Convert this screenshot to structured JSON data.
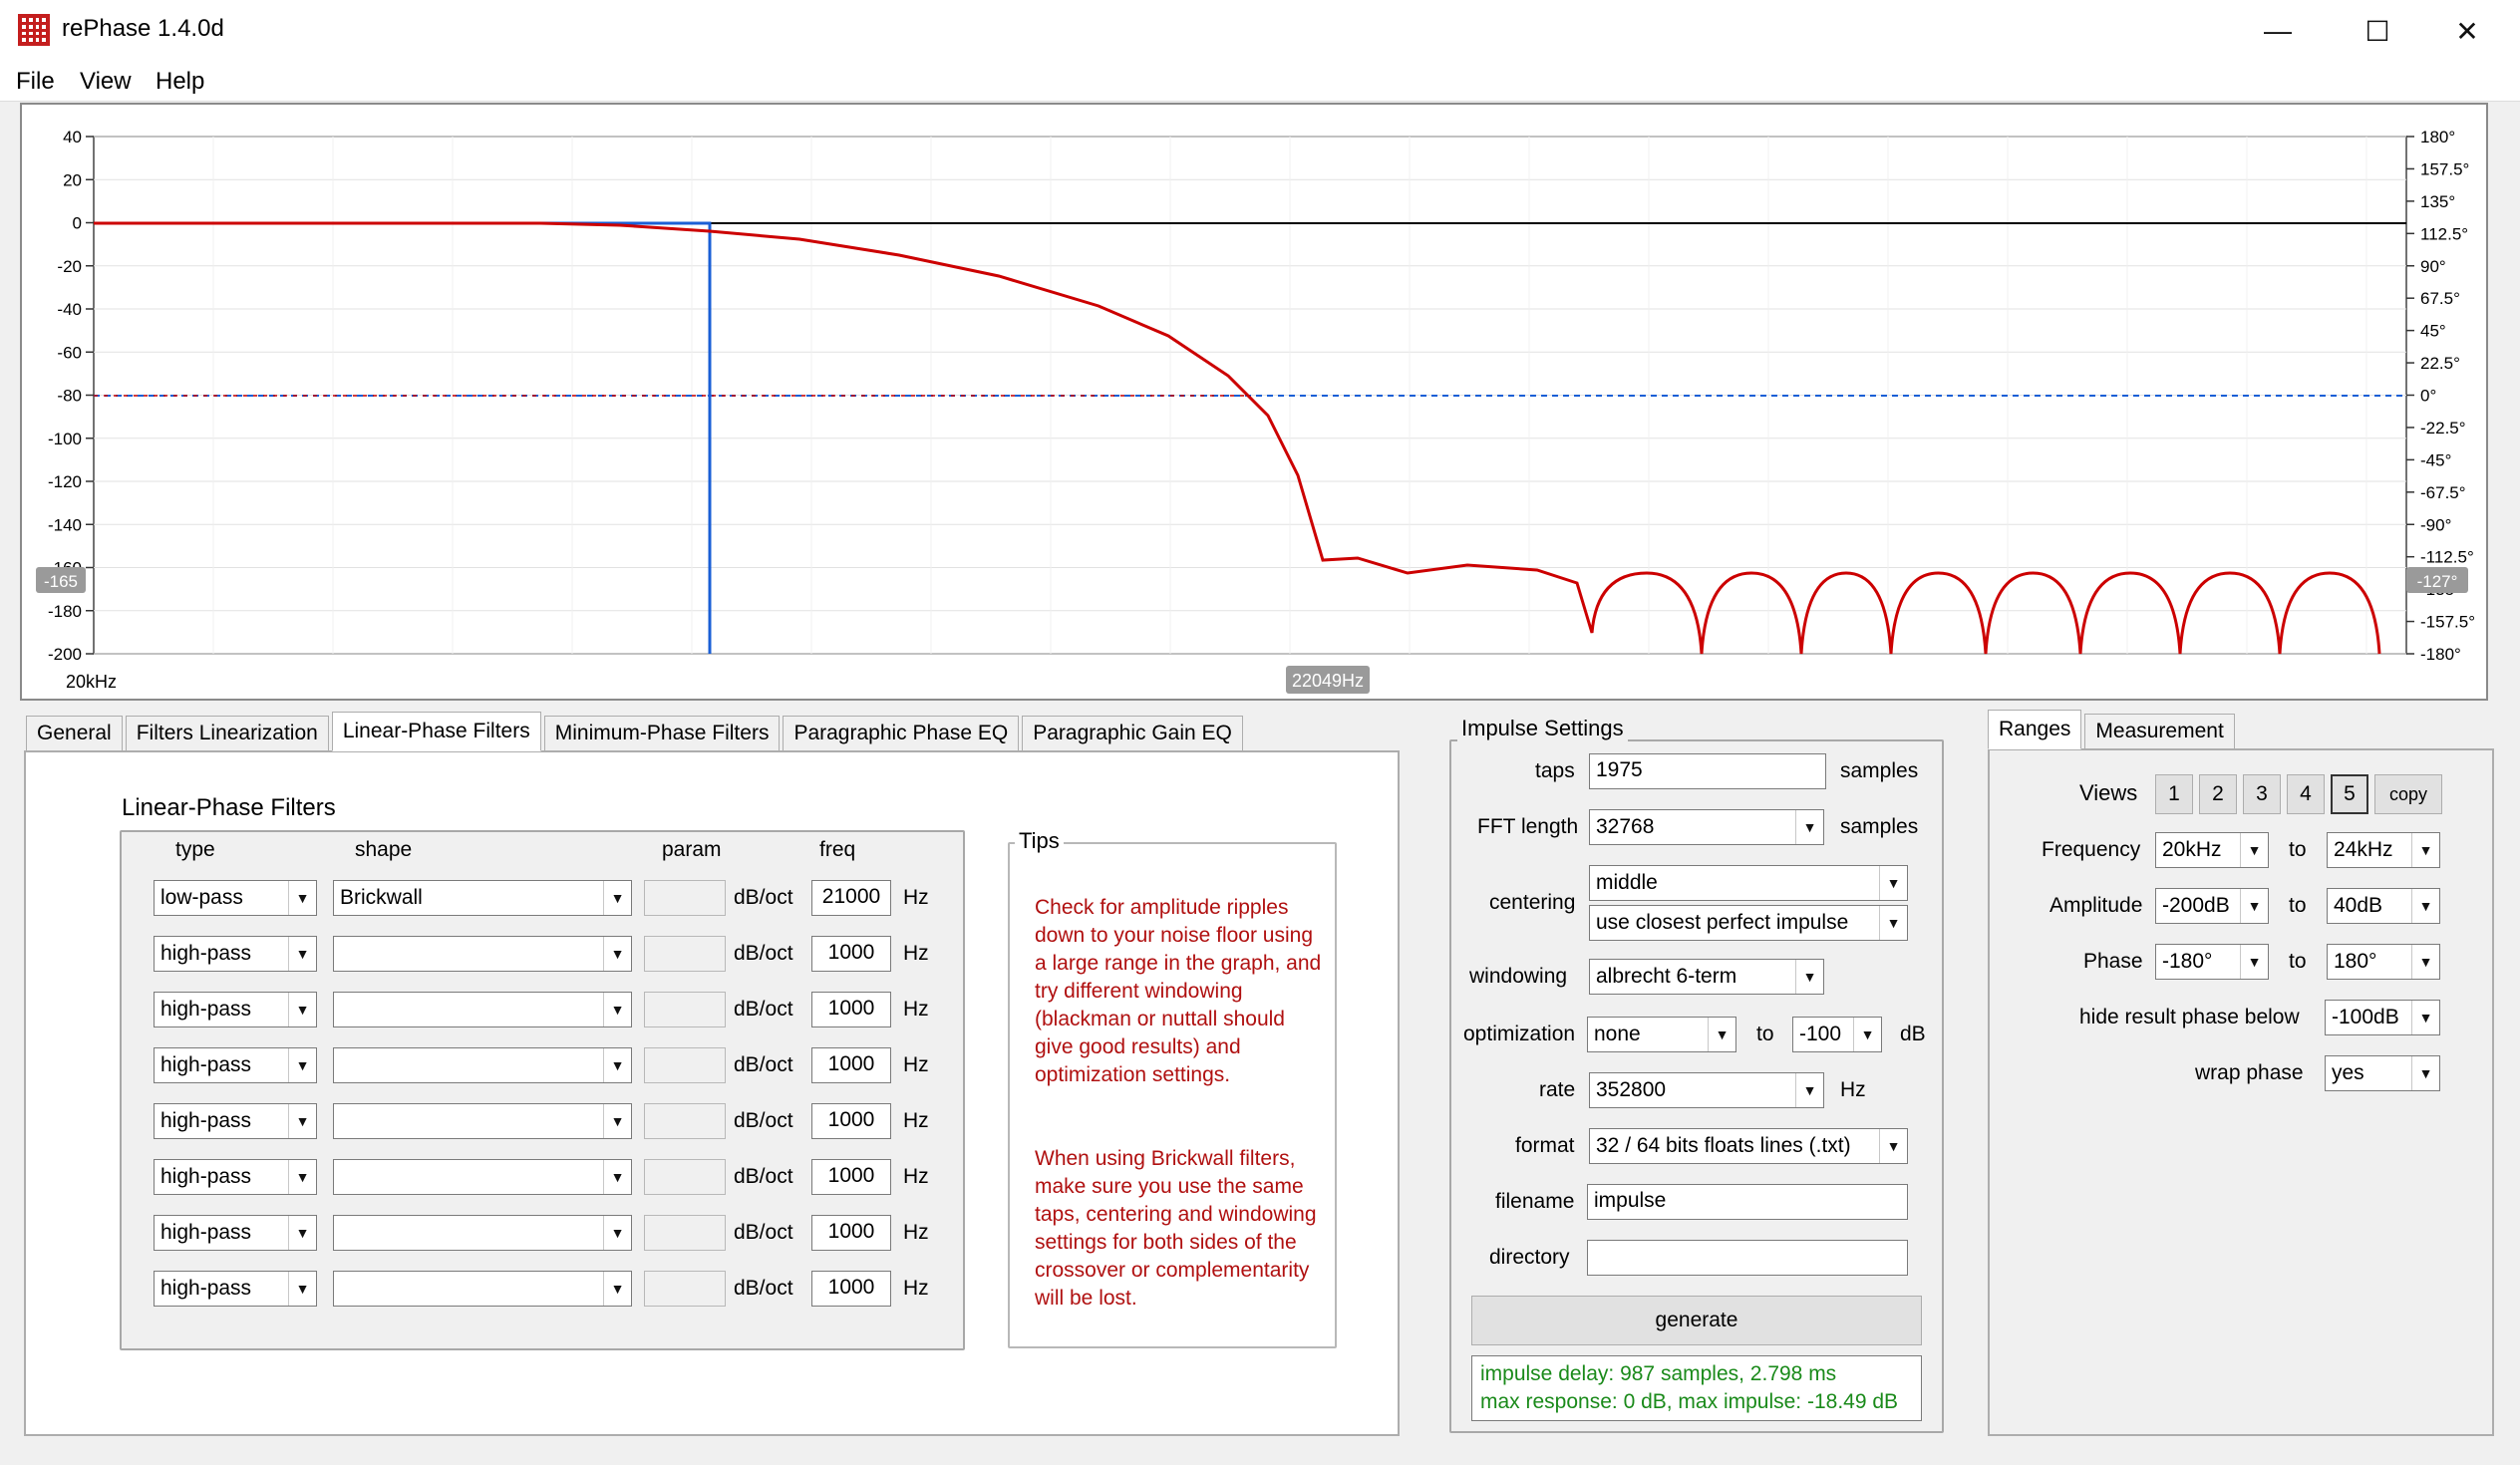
{
  "window": {
    "title": "rePhase 1.4.0d",
    "minimize": "—",
    "maximize": "☐",
    "close": "✕"
  },
  "menu": [
    "File",
    "View",
    "Help"
  ],
  "graph": {
    "left_ticks": [
      "40",
      "20",
      "0",
      "-20",
      "-40",
      "-60",
      "-80",
      "-100",
      "-120",
      "-140",
      "-160",
      "-180",
      "-200"
    ],
    "right_ticks": [
      "180°",
      "157.5°",
      "135°",
      "112.5°",
      "90°",
      "67.5°",
      "45°",
      "22.5°",
      "0°",
      "-22.5°",
      "-45°",
      "-67.5°",
      "-90°",
      "-112.5°",
      "-135°",
      "-157.5°",
      "-180°"
    ],
    "x_start": "20kHz",
    "cursor_x": "22049Hz",
    "cursor_left": "-165",
    "cursor_right": "-127°"
  },
  "tabs": [
    "General",
    "Filters Linearization",
    "Linear-Phase Filters",
    "Minimum-Phase Filters",
    "Paragraphic Phase EQ",
    "Paragraphic Gain EQ"
  ],
  "lpf": {
    "title": "Linear-Phase Filters",
    "headers": {
      "type": "type",
      "shape": "shape",
      "param": "param",
      "freq": "freq"
    },
    "rows": [
      {
        "type": "low-pass",
        "shape": "Brickwall",
        "unit": "dB/oct",
        "freq": "21000",
        "hz": "Hz"
      },
      {
        "type": "high-pass",
        "shape": "",
        "unit": "dB/oct",
        "freq": "1000",
        "hz": "Hz"
      },
      {
        "type": "high-pass",
        "shape": "",
        "unit": "dB/oct",
        "freq": "1000",
        "hz": "Hz"
      },
      {
        "type": "high-pass",
        "shape": "",
        "unit": "dB/oct",
        "freq": "1000",
        "hz": "Hz"
      },
      {
        "type": "high-pass",
        "shape": "",
        "unit": "dB/oct",
        "freq": "1000",
        "hz": "Hz"
      },
      {
        "type": "high-pass",
        "shape": "",
        "unit": "dB/oct",
        "freq": "1000",
        "hz": "Hz"
      },
      {
        "type": "high-pass",
        "shape": "",
        "unit": "dB/oct",
        "freq": "1000",
        "hz": "Hz"
      },
      {
        "type": "high-pass",
        "shape": "",
        "unit": "dB/oct",
        "freq": "1000",
        "hz": "Hz"
      }
    ],
    "tips_title": "Tips",
    "tips1": "Check for amplitude ripples down to your noise floor using a large range in the graph, and try different windowing (blackman or nuttall should give good results) and optimization settings.",
    "tips2": "When using Brickwall filters, make sure you use the same taps, centering and windowing settings for both sides of the crossover or complementarity will be lost."
  },
  "impulse": {
    "title": "Impulse Settings",
    "taps_label": "taps",
    "taps": "1975",
    "samples": "samples",
    "fft_label": "FFT length",
    "fft": "32768",
    "centering_label": "centering",
    "centering1": "middle",
    "centering2": "use closest perfect impulse",
    "windowing_label": "windowing",
    "windowing": "albrecht 6-term",
    "optimization_label": "optimization",
    "optimization": "none",
    "to": "to",
    "opt_to": "-100",
    "db": "dB",
    "rate_label": "rate",
    "rate": "352800",
    "hz": "Hz",
    "format_label": "format",
    "format": "32 / 64 bits floats lines (.txt)",
    "filename_label": "filename",
    "filename": "impulse",
    "directory_label": "directory",
    "directory": "",
    "generate": "generate",
    "status1": "impulse delay: 987 samples, 2.798 ms",
    "status2": "max response: 0 dB, max impulse: -18.49 dB"
  },
  "ranges": {
    "tabs": [
      "Ranges",
      "Measurement"
    ],
    "views_label": "Views",
    "views": [
      "1",
      "2",
      "3",
      "4",
      "5"
    ],
    "copy": "copy",
    "frequency_label": "Frequency",
    "freq_from": "20kHz",
    "freq_to": "24kHz",
    "amplitude_label": "Amplitude",
    "amp_from": "-200dB",
    "amp_to": "40dB",
    "phase_label": "Phase",
    "phase_from": "-180°",
    "phase_to": "180°",
    "to": "to",
    "hide_label": "hide result phase below",
    "hide": "-100dB",
    "wrap_label": "wrap phase",
    "wrap": "yes"
  },
  "colors": {
    "amplitude": "#cc0000",
    "phase": "#1a5fd6",
    "accent": "#c41e1e"
  }
}
